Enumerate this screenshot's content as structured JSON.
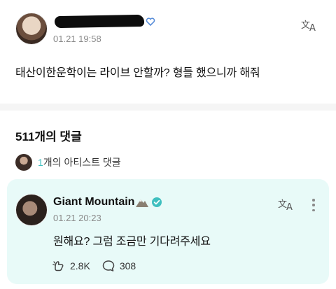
{
  "post": {
    "author_name_hidden": "",
    "time": "01.21 19:58",
    "body": "태산이한운학이는 라이브 안할까? 형들 했으니까 해줘"
  },
  "comments": {
    "count_label": "511개의 댓글",
    "artist_reply": {
      "count": "1",
      "label_suffix": "개의 아티스트 댓글"
    }
  },
  "artist_comment": {
    "author": "Giant Mountain",
    "time": "01.21 20:23",
    "body": "원해요? 그럼 조금만 기다려주세요",
    "likes": "2.8K",
    "replies": "308"
  },
  "colors": {
    "card_bg": "#e8faf8",
    "accent": "#3fbfbf",
    "divider": "#f5f5f5"
  },
  "icons": {
    "translate": "translate-icon",
    "more": "more-vertical-icon",
    "like": "cheer-icon",
    "reply": "comment-bubble-icon",
    "verified": "verified-check-icon",
    "mountain": "mountain-emoji-icon"
  }
}
